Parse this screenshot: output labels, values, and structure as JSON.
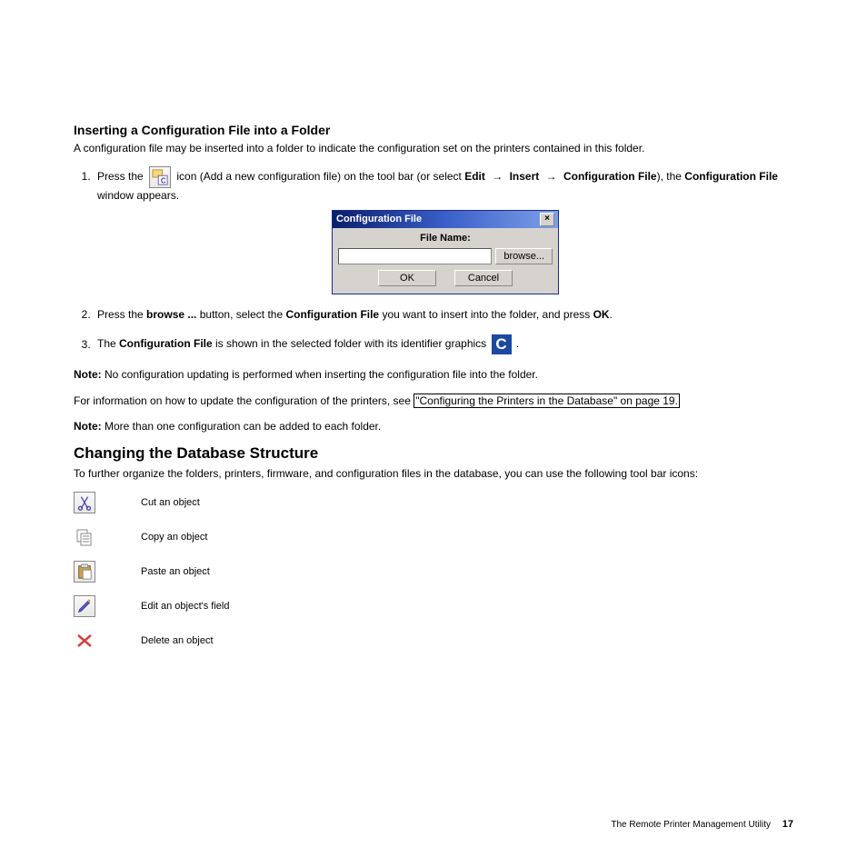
{
  "section1": {
    "heading": "Inserting a Configuration File into a Folder",
    "intro": "A configuration file may be inserted into a folder to indicate the configuration set on the printers contained in this folder.",
    "step1_a": "Press the ",
    "step1_b": " icon (Add a new configuration file) on the tool bar (or select ",
    "step1_edit": "Edit",
    "step1_insert": "Insert",
    "step1_cfgfile": "Configuration File",
    "step1_c": "), the ",
    "step1_cfgfile2": "Configuration File",
    "step1_d": " window appears.",
    "step2_a": "Press the ",
    "step2_browse": "browse ...",
    "step2_b": " button, select the ",
    "step2_cfg": "Configuration File",
    "step2_c": " you want to insert into the folder, and press ",
    "step2_ok": "OK",
    "step2_d": ".",
    "step3_a": "The ",
    "step3_cfg": "Configuration File",
    "step3_b": " is shown in the selected folder with its identifier graphics ",
    "step3_c": " .",
    "note1_label": "Note:",
    "note1_text": "  No configuration updating is performed when inserting the configuration file into the folder.",
    "info_a": "For information on how to update the configuration of the printers, see ",
    "info_link": "\"Configuring the Printers in the Database\" on page 19.",
    "note2_label": "Note:",
    "note2_text": "  More than one configuration can be added to each folder."
  },
  "dialog": {
    "title": "Configuration File",
    "close": "×",
    "label": "File Name:",
    "browse": "browse...",
    "ok": "OK",
    "cancel": "Cancel"
  },
  "section2": {
    "heading": "Changing the Database Structure",
    "intro": "To further organize the folders, printers, firmware, and configuration files in the database, you can use the following tool bar icons:",
    "rows": [
      "Cut an object",
      "Copy an object",
      "Paste an object",
      "Edit an object's field",
      "Delete an object"
    ]
  },
  "footer": {
    "text": "The Remote Printer Management Utility",
    "page": "17"
  },
  "arrow_glyph": "→"
}
